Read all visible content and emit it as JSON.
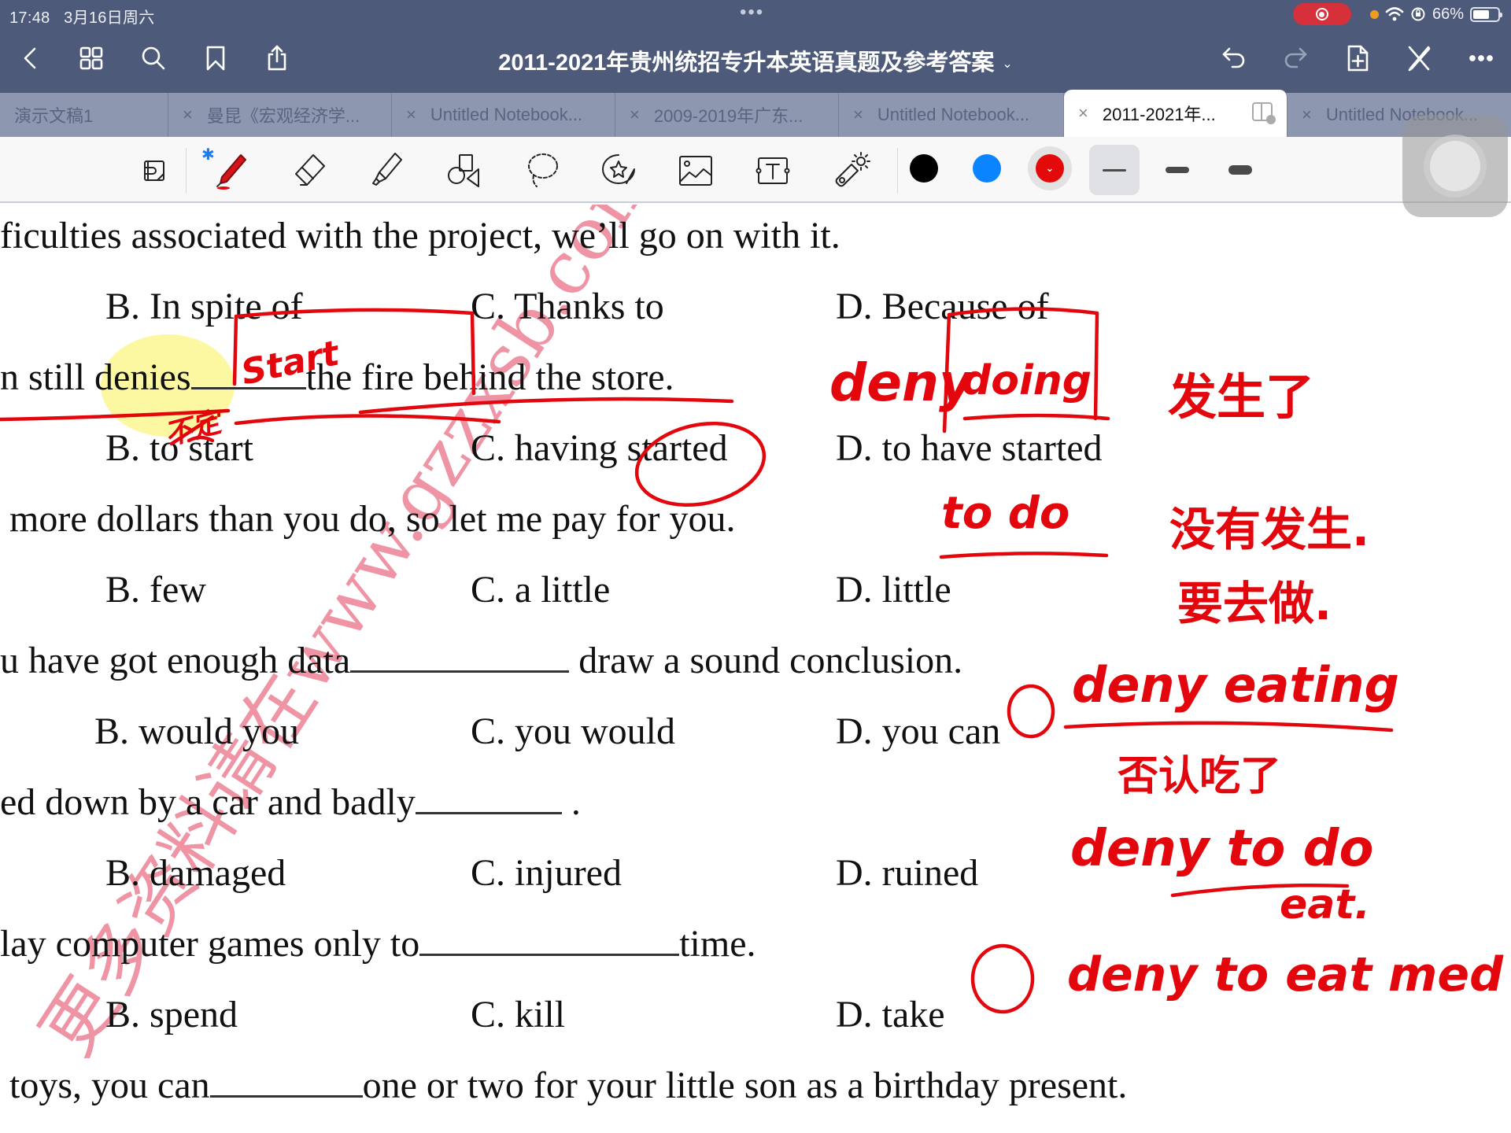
{
  "status_bar": {
    "time": "17:48",
    "date": "3月16日周六",
    "multitask_dots": "•••",
    "battery_percent": "66%",
    "battery_level": 0.66,
    "icons": [
      "screen-record-icon",
      "mic-indicator-dot",
      "wifi-icon",
      "orientation-lock-icon",
      "battery-icon"
    ]
  },
  "nav": {
    "title": "2011-2021年贵州统招专升本英语真题及参考答案",
    "title_chevron": "⌄",
    "left_icons": [
      "back-icon",
      "grid-icon",
      "search-icon",
      "bookmark-icon",
      "share-icon"
    ],
    "right_icons": [
      "undo-icon",
      "redo-icon",
      "add-page-icon",
      "pencil-cross-icon",
      "more-icon"
    ]
  },
  "tabs": [
    {
      "label": "演示文稿1",
      "closable": false,
      "active": false
    },
    {
      "label": "曼昆《宏观经济学...",
      "closable": true,
      "active": false
    },
    {
      "label": "Untitled Notebook...",
      "closable": true,
      "active": false
    },
    {
      "label": "2009-2019年广东...",
      "closable": true,
      "active": false
    },
    {
      "label": "Untitled Notebook...",
      "closable": true,
      "active": false
    },
    {
      "label": "2011-2021年...",
      "closable": true,
      "active": true
    },
    {
      "label": "Untitled Notebook...",
      "closable": true,
      "active": false
    }
  ],
  "tab_close_glyph": "×",
  "toolbar": {
    "bluetooth_glyph": "✱",
    "tools": [
      "read-mode-icon",
      "pen-icon",
      "eraser-icon",
      "highlighter-icon",
      "shapes-icon",
      "lasso-icon",
      "sticker-icon",
      "image-icon",
      "text-box-icon",
      "laser-pointer-icon"
    ],
    "selected_tool": "pen",
    "colors": [
      {
        "name": "black",
        "hex": "#000000"
      },
      {
        "name": "blue",
        "hex": "#0a84ff"
      },
      {
        "name": "red",
        "hex": "#e20a0a",
        "selected": true
      }
    ],
    "color_chevron": "⌄",
    "stroke_widths": [
      "thin",
      "medium",
      "thick"
    ],
    "selected_stroke": "thin"
  },
  "document": {
    "lines": [
      {
        "text": "ficulties associated with the project, we’ll go on with it."
      },
      {
        "options": [
          "B. In spite of",
          "C. Thanks to",
          "D. Because of"
        ]
      },
      {
        "before": "n still denies",
        "after": "the fire behind the store."
      },
      {
        "options": [
          "B. to start",
          "C. having started",
          "D. to have started"
        ]
      },
      {
        "text": " more dollars than you do, so let me pay for you."
      },
      {
        "options": [
          "B. few",
          "C. a little",
          "D. little"
        ]
      },
      {
        "before": "u have got enough data",
        "after": " draw a sound conclusion."
      },
      {
        "options": [
          "B. would you",
          "C. you would",
          "D. you can"
        ]
      },
      {
        "before": "ed down by a car and badly",
        "after": " ."
      },
      {
        "options": [
          "B. damaged",
          "C. injured",
          "D. ruined"
        ]
      },
      {
        "before": "lay computer games only to",
        "after": "time."
      },
      {
        "options": [
          "B. spend",
          "C. kill",
          "D. take"
        ]
      },
      {
        "before": " toys, you can",
        "after": "one or two for your little son as a birthday present."
      }
    ],
    "watermark": "更多资料请在www.gzzxsb.com"
  },
  "annotations": {
    "blank_answer": "Start",
    "under_label": "不定",
    "deny_doing": "deny",
    "doing": "doing",
    "note_happened": "发生了",
    "to_do": "to do",
    "note_not_happened": "没有发生.",
    "note_going_to_do": "要去做.",
    "circle_1": "①",
    "deny_eating": "deny eating",
    "note_denied_eating": "否认吃了",
    "deny_to_do": "deny to do",
    "eat": "eat.",
    "deny_to_eat_med": "deny to eat med"
  }
}
